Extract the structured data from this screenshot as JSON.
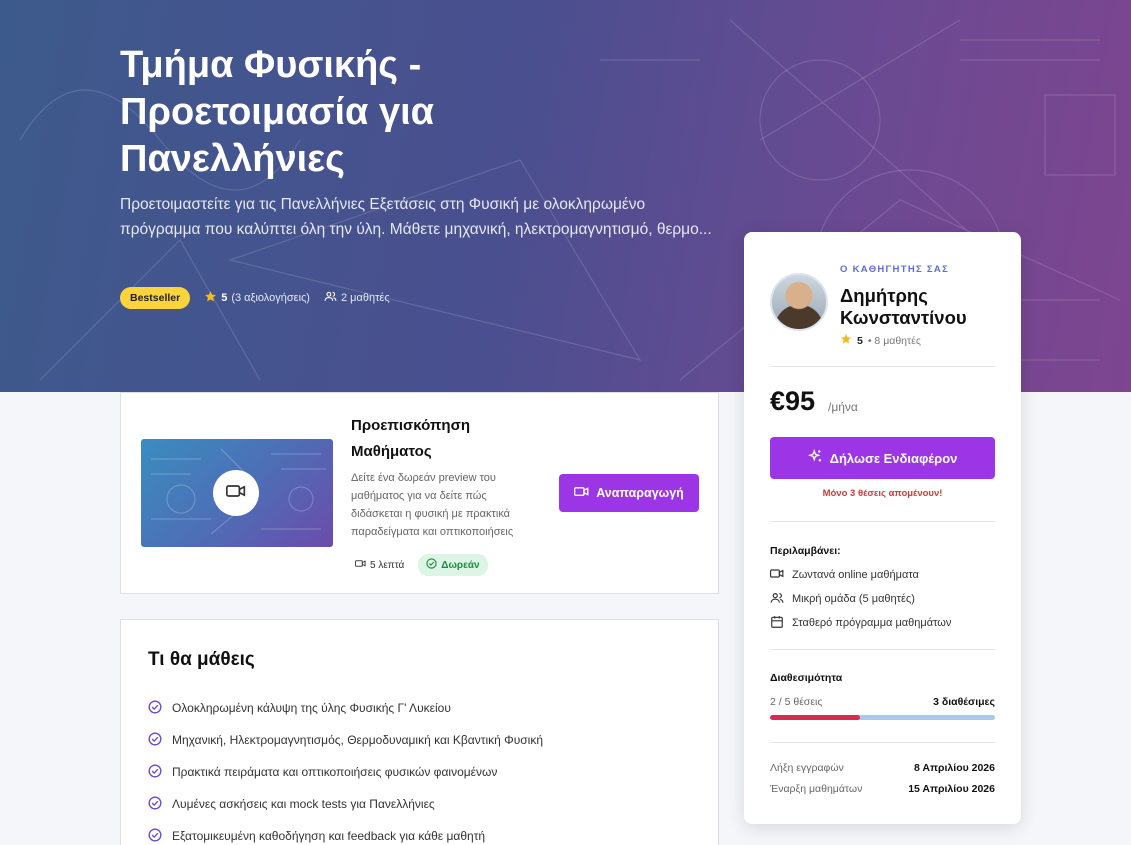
{
  "hero": {
    "title": "Τμήμα Φυσικής - Προετοιμασία για Πανελλήνιες",
    "description": "Προετοιμαστείτε για τις Πανελλήνιες Εξετάσεις στη Φυσική με ολοκληρωμένο πρόγραμμα που καλύπτει όλη την ύλη. Μάθετε μηχανική, ηλεκτρομαγνητισμό, θερμο...",
    "badge": "Bestseller",
    "rating": "5",
    "reviews": "(3 αξιολογήσεις)",
    "students": "2 μαθητές"
  },
  "preview": {
    "title": "Προεπισκόπηση Μαθήματος",
    "description": "Δείτε ένα δωρεάν preview του μαθήματος για να δείτε πώς διδάσκεται η φυσική με πρακτικά παραδείγματα και οπτικοποιήσεις",
    "duration": "5 λεπτά",
    "free": "Δωρεάν",
    "play_label": "Αναπαραγωγή"
  },
  "learn": {
    "title": "Τι θα μάθεις",
    "items": [
      "Ολοκληρωμένη κάλυψη της ύλης Φυσικής Γ' Λυκείου",
      "Μηχανική, Ηλεκτρομαγνητισμός, Θερμοδυναμική και Κβαντική Φυσική",
      "Πρακτικά πειράματα και οπτικοποιήσεις φυσικών φαινομένων",
      "Λυμένες ασκήσεις και mock tests για Πανελλήνιες",
      "Εξατομικευμένη καθοδήγηση και feedback για κάθε μαθητή"
    ]
  },
  "sidebar": {
    "teacher_label": "Ο ΚΑΘΗΓΗΤΗΣ ΣΑΣ",
    "teacher_name": "Δημήτρης Κωνσταντίνου",
    "teacher_rating": "5",
    "teacher_students": "• 8 μαθητές",
    "price": "€95",
    "per": "/μήνα",
    "interest_label": "Δήλωσε Ενδιαφέρον",
    "seats_left": "Μόνο 3 θέσεις απομένουν!",
    "includes_title": "Περιλαμβάνει:",
    "includes": [
      "Ζωντανά online μαθήματα",
      "Μικρή ομάδα (5 μαθητές)",
      "Σταθερό πρόγραμμα μαθημάτων"
    ],
    "availability_title": "Διαθεσιμότητα",
    "availability_taken": "2 / 5 θέσεις",
    "availability_free": "3 διαθέσιμες",
    "availability_fraction": 0.4,
    "deadline_label": "Λήξη εγγραφών",
    "deadline_value": "8 Απριλίου 2026",
    "start_label": "Έναρξη μαθημάτων",
    "start_value": "15 Απριλίου 2026"
  },
  "colors": {
    "accent": "#9b35e6",
    "badge": "#fbd33c",
    "warning": "#d23a3a",
    "bar_taken": "#d92b4f",
    "bar_free": "#a9c8ec"
  }
}
